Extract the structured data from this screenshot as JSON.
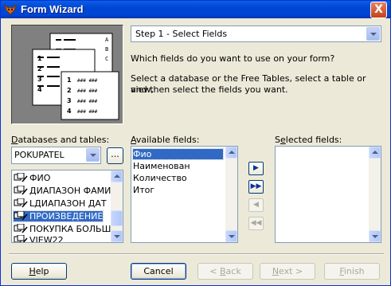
{
  "window": {
    "title": "Form Wizard",
    "close_label": "X"
  },
  "step": {
    "selected": "Step 1 - Select Fields"
  },
  "instructions": {
    "question": "Which fields do you want to use on your form?",
    "line1": "Select a database or the Free Tables, select a table or view,",
    "line2": "and then select the fields you want."
  },
  "databases": {
    "label_underlined": "D",
    "label_rest": "atabases and tables:",
    "selected": "POKUPATEL",
    "browse_label": "...",
    "tables": [
      "ФИО",
      "ДИАПАЗОН ФАМИ",
      "LДИАПАЗОН ДАТ",
      "ПРОИЗВЕДЕНИЕ",
      "ПОКУПКА БОЛЬШЕ",
      "VIEW22"
    ],
    "selected_table_index": 3
  },
  "available": {
    "label_underlined": "A",
    "label_rest": "vailable fields:",
    "items": [
      "Фио",
      "Наименован",
      "Количество",
      "Итог"
    ],
    "selected_index": 0
  },
  "selected_fields": {
    "label_prefix": "S",
    "label_underlined": "e",
    "label_rest": "lected fields:",
    "items": []
  },
  "move_buttons": {
    "add": "▶",
    "add_all": "▶▶",
    "remove": "◀",
    "remove_all": "◀◀"
  },
  "buttons": {
    "help_u": "H",
    "help_rest": "elp",
    "cancel": "Cancel",
    "back_prefix": "< ",
    "back_u": "B",
    "back_rest": "ack",
    "next_u": "N",
    "next_rest": "ext >",
    "finish_u": "F",
    "finish_rest": "inish"
  },
  "illustration": {
    "rows": [
      "1",
      "2",
      "3",
      "4"
    ],
    "row_cells": "### ###",
    "col_letters": [
      "A",
      "B",
      "C"
    ]
  },
  "colors": {
    "title_bar": "#0046d5",
    "selection": "#316ac5",
    "window_bg": "#ece9d8"
  }
}
